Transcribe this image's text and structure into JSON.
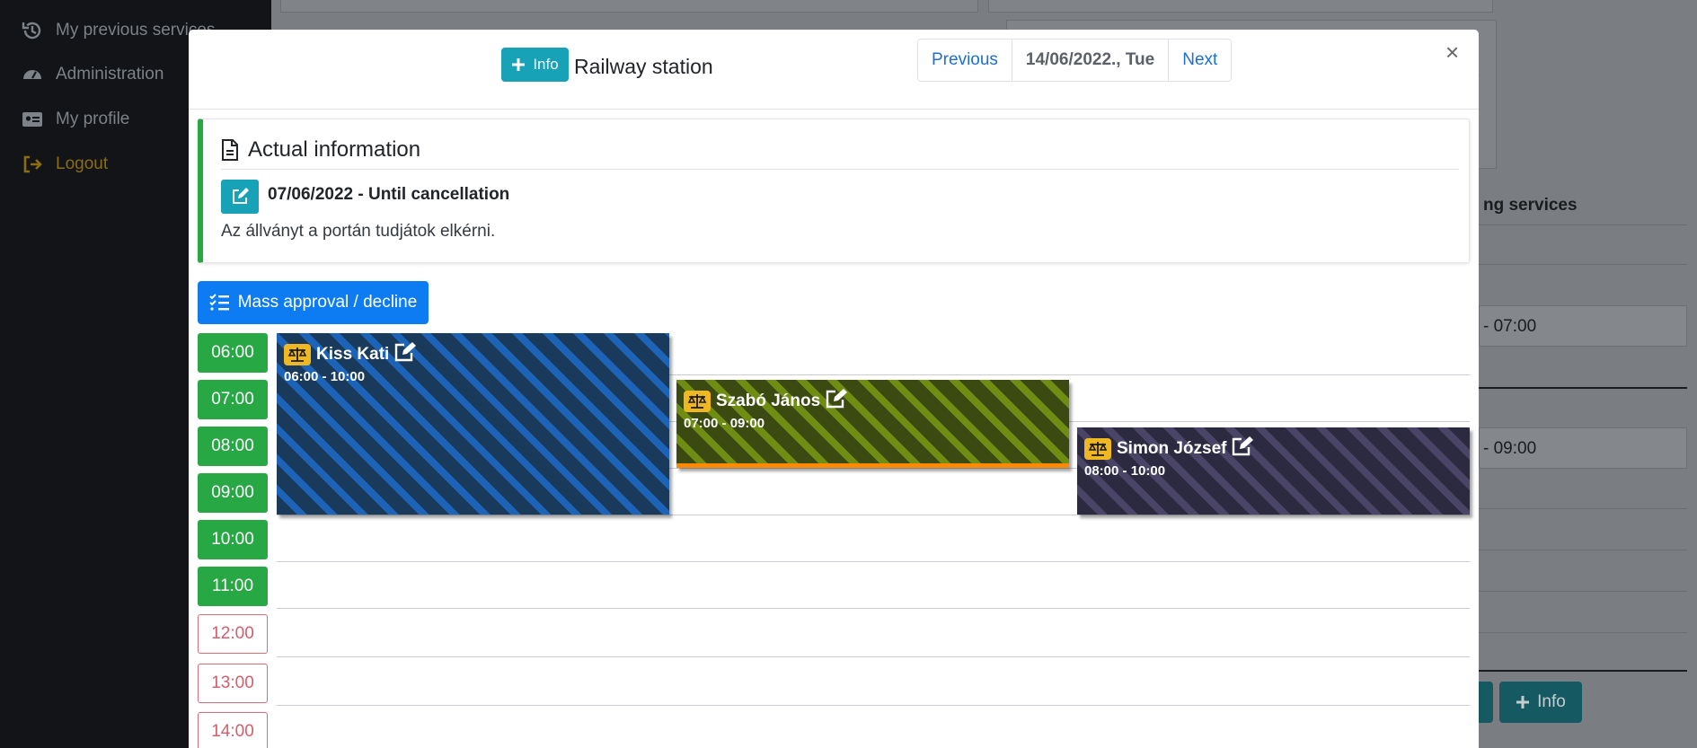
{
  "sidebar": {
    "items": [
      {
        "label": "My previous services",
        "icon": "history-icon"
      },
      {
        "label": "Administration",
        "icon": "dashboard-icon"
      },
      {
        "label": "My profile",
        "icon": "id-card-icon"
      },
      {
        "label": "Logout",
        "icon": "sign-out-icon"
      }
    ]
  },
  "background": {
    "section_title": "ng services",
    "row_time_1": "- 07:00",
    "row_time_2": "- 09:00",
    "info_label": "Info"
  },
  "modal": {
    "info_button": "Info",
    "title": "Railway station",
    "nav": {
      "previous": "Previous",
      "date": "14/06/2022., Tue",
      "next": "Next"
    },
    "close": "×",
    "actual_info": {
      "title": "Actual information",
      "date_range": "07/06/2022 - Until cancellation",
      "text": "Az állványt a portán tudjátok elkérni."
    },
    "mass_button": "Mass approval / decline",
    "hours": [
      {
        "label": "06:00",
        "state": "free"
      },
      {
        "label": "07:00",
        "state": "free"
      },
      {
        "label": "08:00",
        "state": "free"
      },
      {
        "label": "09:00",
        "state": "free"
      },
      {
        "label": "10:00",
        "state": "free"
      },
      {
        "label": "11:00",
        "state": "free"
      },
      {
        "label": "12:00",
        "state": "past"
      },
      {
        "label": "13:00",
        "state": "past"
      },
      {
        "label": "14:00",
        "state": "past"
      }
    ],
    "bookings": [
      {
        "name": "Kiss Kati",
        "time": "06:00 - 10:00"
      },
      {
        "name": "Szabó János",
        "time": "07:00 - 09:00"
      },
      {
        "name": "Simon József",
        "time": "08:00 - 10:00"
      }
    ]
  },
  "colors": {
    "accent_info": "#17a2b8",
    "primary": "#0d7cf2",
    "success": "#28a745",
    "danger": "#d45e6c",
    "badge": "#f0b820"
  }
}
